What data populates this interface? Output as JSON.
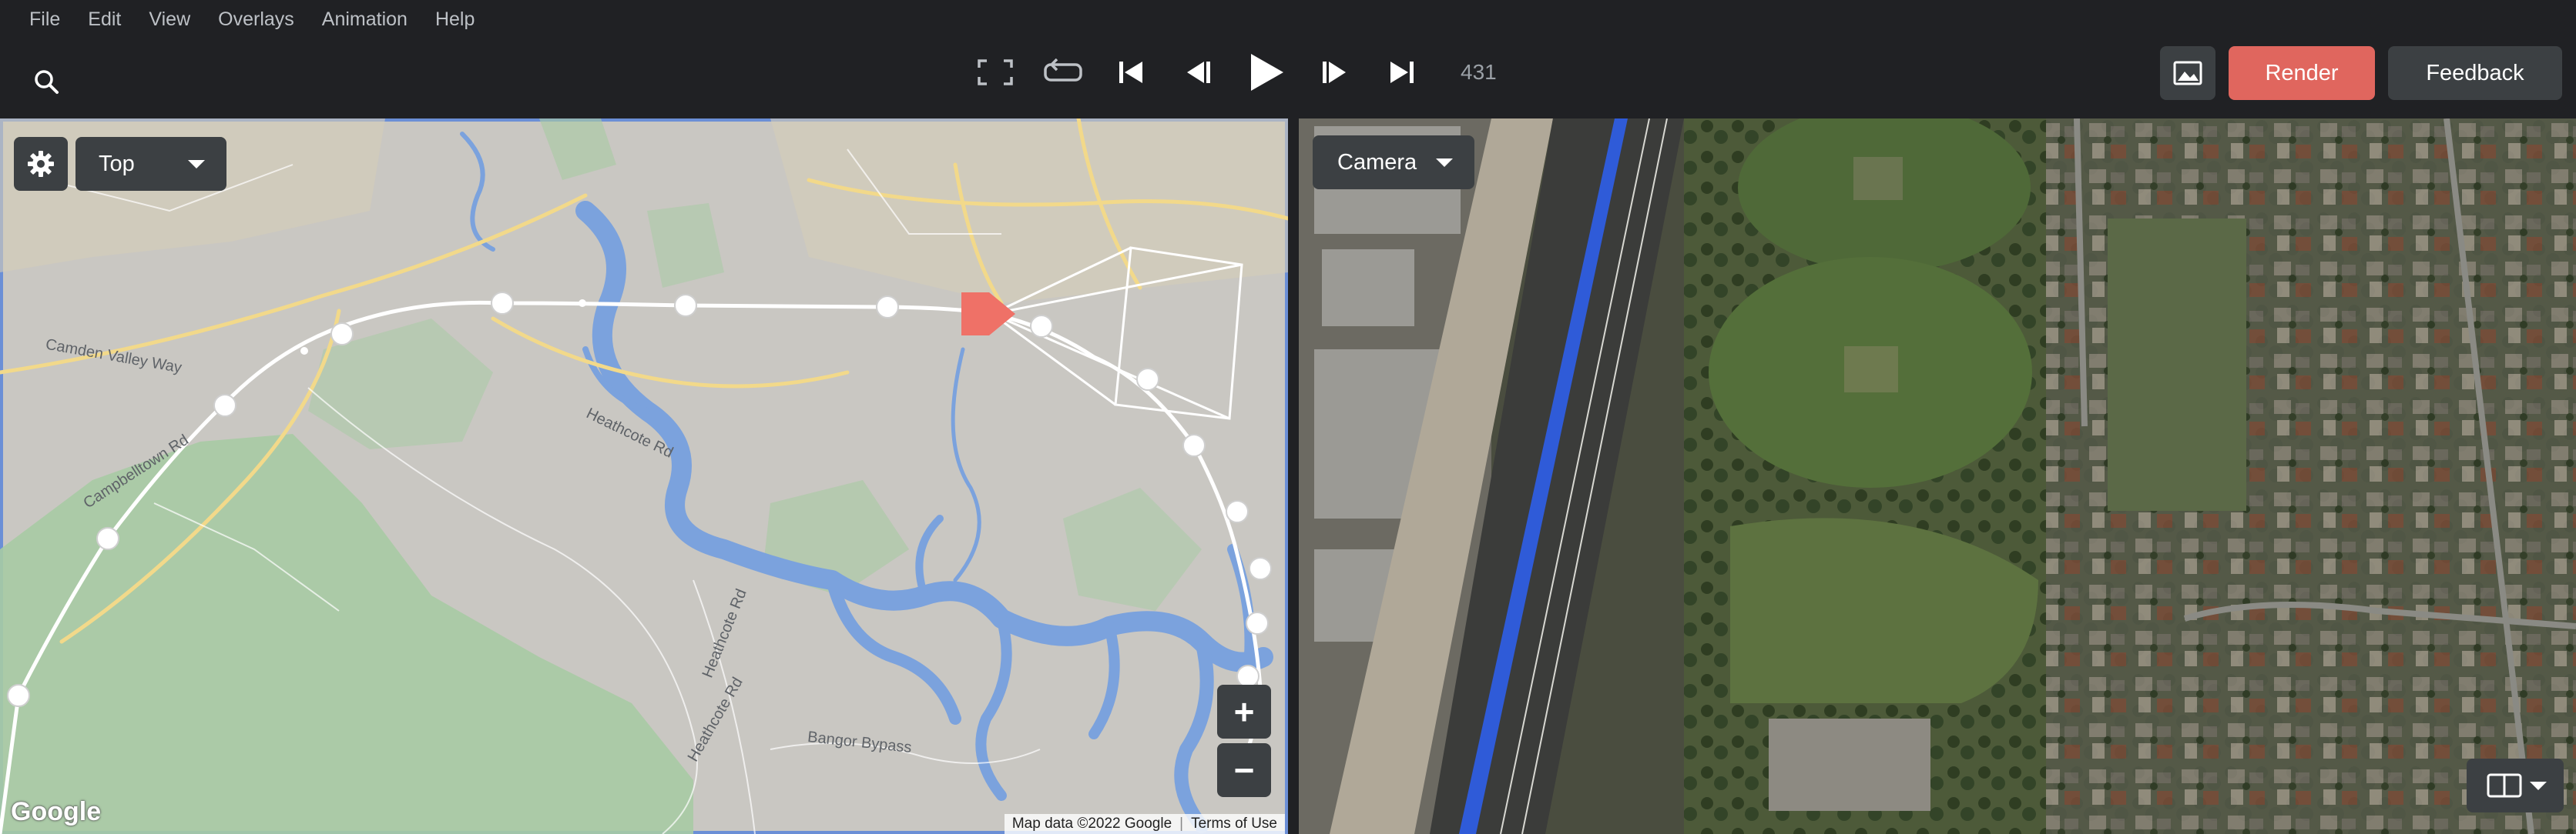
{
  "menu": [
    "File",
    "Edit",
    "View",
    "Overlays",
    "Animation",
    "Help"
  ],
  "transport": {
    "frame": "431"
  },
  "toolbar": {
    "render_label": "Render",
    "feedback_label": "Feedback"
  },
  "map_view": {
    "selected_view": "Top",
    "labels": {
      "camden_valley_way": "Camden Valley Way",
      "campbelltown_rd": "Campbelltown Rd",
      "heathcote_rd_1": "Heathcote Rd",
      "heathcote_rd_2": "Heathcote Rd",
      "heathcote_rd_3": "Heathcote Rd",
      "bangor_bypass": "Bangor Bypass"
    },
    "logo": "Google",
    "attribution": {
      "map_data": "Map data ©2022 Google",
      "terms": "Terms of Use"
    },
    "zoom_in": "+",
    "zoom_out": "−",
    "colors": {
      "water": "#7ba2dd",
      "park": "#9fc9a0",
      "path": "#ffffff",
      "camera_marker": "#ef7167"
    }
  },
  "camera_view": {
    "selected_view": "Camera",
    "colors": {
      "route_highlight": "#2f5bd8"
    }
  },
  "icons": [
    "search-icon",
    "fullscreen-icon",
    "loop-icon",
    "skip-start-icon",
    "step-back-icon",
    "play-icon",
    "step-forward-icon",
    "skip-end-icon",
    "image-icon",
    "gear-icon",
    "chevron-down-icon",
    "split-layout-icon",
    "camera-marker-icon"
  ]
}
